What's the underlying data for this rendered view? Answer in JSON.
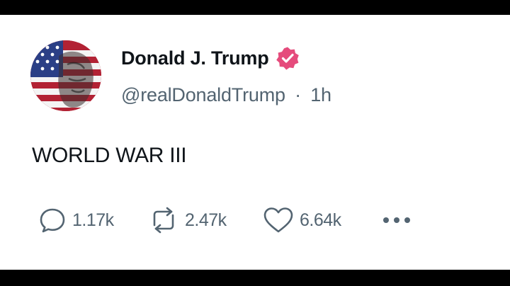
{
  "post": {
    "author_name": "Donald J. Trump",
    "handle": "@realDonaldTrump",
    "separator": "·",
    "time": "1h",
    "text": "WORLD WAR III",
    "verified_color": "#e54b7c"
  },
  "actions": {
    "replies": "1.17k",
    "reposts": "2.47k",
    "likes": "6.64k",
    "reply_icon": "comment-bubble-icon",
    "repost_icon": "repost-arrows-icon",
    "like_icon": "heart-icon",
    "more_icon": "more-dots-icon"
  }
}
